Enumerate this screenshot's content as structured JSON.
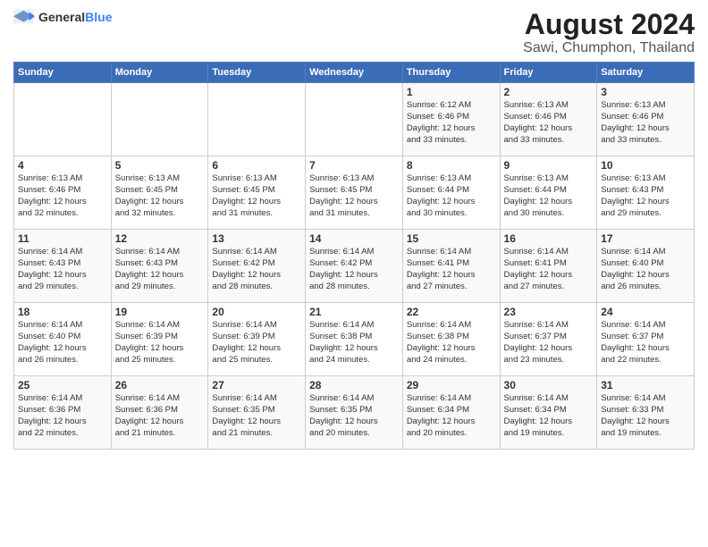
{
  "header": {
    "logo_general": "General",
    "logo_blue": "Blue",
    "title": "August 2024",
    "subtitle": "Sawi, Chumphon, Thailand"
  },
  "weekdays": [
    "Sunday",
    "Monday",
    "Tuesday",
    "Wednesday",
    "Thursday",
    "Friday",
    "Saturday"
  ],
  "weeks": [
    [
      {
        "day": "",
        "info": ""
      },
      {
        "day": "",
        "info": ""
      },
      {
        "day": "",
        "info": ""
      },
      {
        "day": "",
        "info": ""
      },
      {
        "day": "1",
        "info": "Sunrise: 6:12 AM\nSunset: 6:46 PM\nDaylight: 12 hours\nand 33 minutes."
      },
      {
        "day": "2",
        "info": "Sunrise: 6:13 AM\nSunset: 6:46 PM\nDaylight: 12 hours\nand 33 minutes."
      },
      {
        "day": "3",
        "info": "Sunrise: 6:13 AM\nSunset: 6:46 PM\nDaylight: 12 hours\nand 33 minutes."
      }
    ],
    [
      {
        "day": "4",
        "info": "Sunrise: 6:13 AM\nSunset: 6:46 PM\nDaylight: 12 hours\nand 32 minutes."
      },
      {
        "day": "5",
        "info": "Sunrise: 6:13 AM\nSunset: 6:45 PM\nDaylight: 12 hours\nand 32 minutes."
      },
      {
        "day": "6",
        "info": "Sunrise: 6:13 AM\nSunset: 6:45 PM\nDaylight: 12 hours\nand 31 minutes."
      },
      {
        "day": "7",
        "info": "Sunrise: 6:13 AM\nSunset: 6:45 PM\nDaylight: 12 hours\nand 31 minutes."
      },
      {
        "day": "8",
        "info": "Sunrise: 6:13 AM\nSunset: 6:44 PM\nDaylight: 12 hours\nand 30 minutes."
      },
      {
        "day": "9",
        "info": "Sunrise: 6:13 AM\nSunset: 6:44 PM\nDaylight: 12 hours\nand 30 minutes."
      },
      {
        "day": "10",
        "info": "Sunrise: 6:13 AM\nSunset: 6:43 PM\nDaylight: 12 hours\nand 29 minutes."
      }
    ],
    [
      {
        "day": "11",
        "info": "Sunrise: 6:14 AM\nSunset: 6:43 PM\nDaylight: 12 hours\nand 29 minutes."
      },
      {
        "day": "12",
        "info": "Sunrise: 6:14 AM\nSunset: 6:43 PM\nDaylight: 12 hours\nand 29 minutes."
      },
      {
        "day": "13",
        "info": "Sunrise: 6:14 AM\nSunset: 6:42 PM\nDaylight: 12 hours\nand 28 minutes."
      },
      {
        "day": "14",
        "info": "Sunrise: 6:14 AM\nSunset: 6:42 PM\nDaylight: 12 hours\nand 28 minutes."
      },
      {
        "day": "15",
        "info": "Sunrise: 6:14 AM\nSunset: 6:41 PM\nDaylight: 12 hours\nand 27 minutes."
      },
      {
        "day": "16",
        "info": "Sunrise: 6:14 AM\nSunset: 6:41 PM\nDaylight: 12 hours\nand 27 minutes."
      },
      {
        "day": "17",
        "info": "Sunrise: 6:14 AM\nSunset: 6:40 PM\nDaylight: 12 hours\nand 26 minutes."
      }
    ],
    [
      {
        "day": "18",
        "info": "Sunrise: 6:14 AM\nSunset: 6:40 PM\nDaylight: 12 hours\nand 26 minutes."
      },
      {
        "day": "19",
        "info": "Sunrise: 6:14 AM\nSunset: 6:39 PM\nDaylight: 12 hours\nand 25 minutes."
      },
      {
        "day": "20",
        "info": "Sunrise: 6:14 AM\nSunset: 6:39 PM\nDaylight: 12 hours\nand 25 minutes."
      },
      {
        "day": "21",
        "info": "Sunrise: 6:14 AM\nSunset: 6:38 PM\nDaylight: 12 hours\nand 24 minutes."
      },
      {
        "day": "22",
        "info": "Sunrise: 6:14 AM\nSunset: 6:38 PM\nDaylight: 12 hours\nand 24 minutes."
      },
      {
        "day": "23",
        "info": "Sunrise: 6:14 AM\nSunset: 6:37 PM\nDaylight: 12 hours\nand 23 minutes."
      },
      {
        "day": "24",
        "info": "Sunrise: 6:14 AM\nSunset: 6:37 PM\nDaylight: 12 hours\nand 22 minutes."
      }
    ],
    [
      {
        "day": "25",
        "info": "Sunrise: 6:14 AM\nSunset: 6:36 PM\nDaylight: 12 hours\nand 22 minutes."
      },
      {
        "day": "26",
        "info": "Sunrise: 6:14 AM\nSunset: 6:36 PM\nDaylight: 12 hours\nand 21 minutes."
      },
      {
        "day": "27",
        "info": "Sunrise: 6:14 AM\nSunset: 6:35 PM\nDaylight: 12 hours\nand 21 minutes."
      },
      {
        "day": "28",
        "info": "Sunrise: 6:14 AM\nSunset: 6:35 PM\nDaylight: 12 hours\nand 20 minutes."
      },
      {
        "day": "29",
        "info": "Sunrise: 6:14 AM\nSunset: 6:34 PM\nDaylight: 12 hours\nand 20 minutes."
      },
      {
        "day": "30",
        "info": "Sunrise: 6:14 AM\nSunset: 6:34 PM\nDaylight: 12 hours\nand 19 minutes."
      },
      {
        "day": "31",
        "info": "Sunrise: 6:14 AM\nSunset: 6:33 PM\nDaylight: 12 hours\nand 19 minutes."
      }
    ]
  ]
}
